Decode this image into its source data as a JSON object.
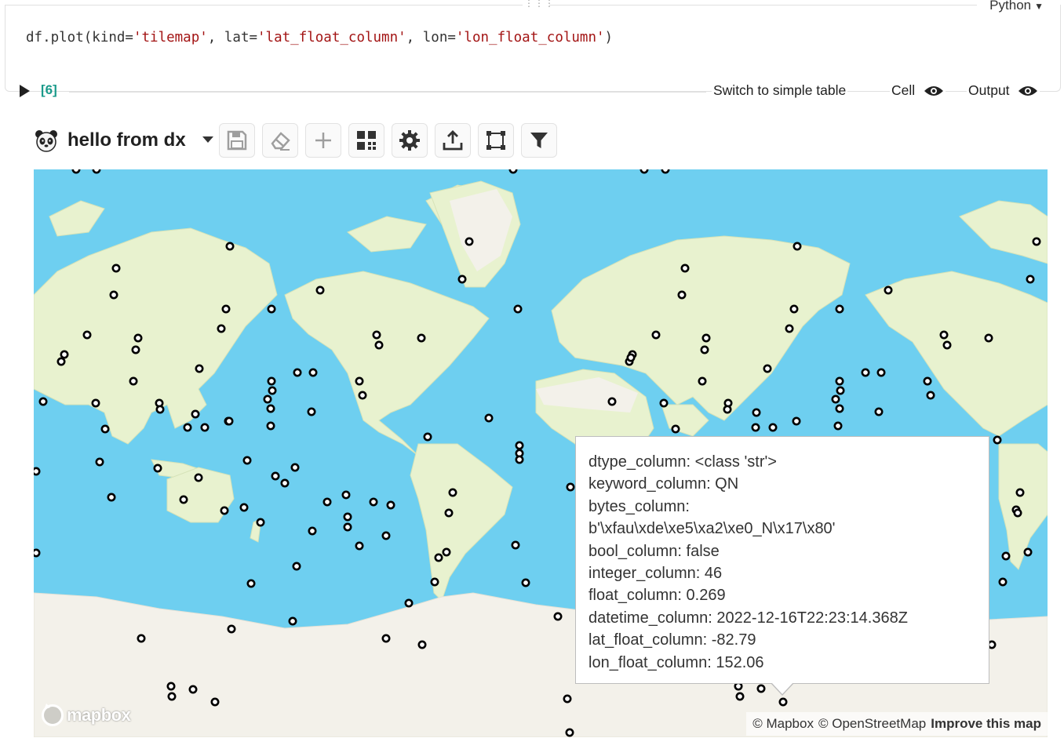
{
  "cell": {
    "language": "Python",
    "code": {
      "prefix": "df.plot(kind=",
      "kind": "'tilemap'",
      "lat_arg": ", lat=",
      "lat": "'lat_float_column'",
      "lon_arg": ", lon=",
      "lon": "'lon_float_column'",
      "suffix": ")"
    },
    "execution_count": "[6]",
    "switch_label": "Switch to simple table",
    "cell_label": "Cell",
    "output_label": "Output"
  },
  "dx": {
    "title": "hello from dx",
    "buttons": [
      "save-icon",
      "eraser-icon",
      "plus-icon",
      "grid-icon",
      "gear-icon",
      "upload-icon",
      "select-region-icon",
      "filter-icon"
    ]
  },
  "map": {
    "water_color": "#6ecff0",
    "land_color": "#e8f2cf",
    "ice_color": "#f3f1ea",
    "attribution": {
      "mapbox": "© Mapbox",
      "osm": "© OpenStreetMap",
      "improve": "Improve this map"
    },
    "logo_text": "mapbox"
  },
  "tooltip": {
    "lines": [
      "dtype_column: <class 'str'>",
      "keyword_column: QN",
      "bytes_column:",
      "b'\\xfau\\xde\\xe5\\xa2\\xe0_N\\x17\\x80'",
      "bool_column: false",
      "integer_column: 46",
      "float_column: 0.269",
      "datetime_column: 2022-12-16T22:23:14.368Z",
      "lat_float_column: -82.79",
      "lon_float_column: 152.06"
    ]
  }
}
